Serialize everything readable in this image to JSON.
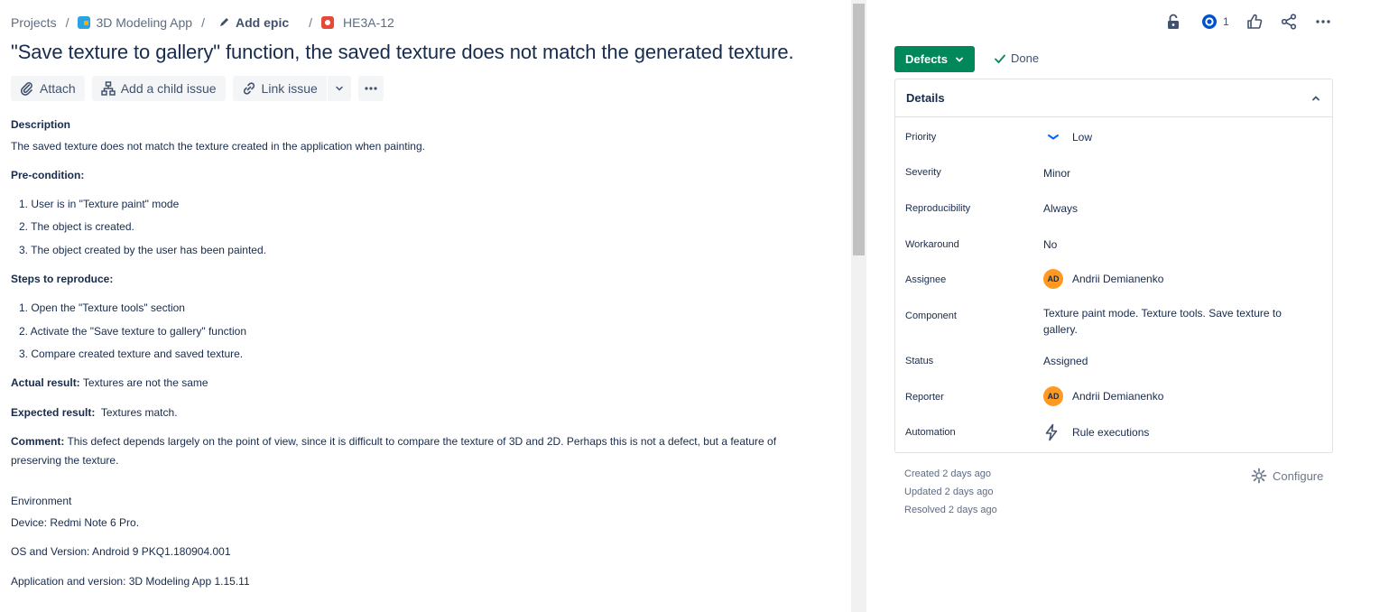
{
  "breadcrumb": {
    "projects": "Projects",
    "separator": "/",
    "app": "3D Modeling App",
    "epic": "Add epic",
    "issue_key": "HE3A-12"
  },
  "issue": {
    "title": "\"Save texture to gallery\" function, the saved texture does not match the generated texture."
  },
  "toolbar": {
    "attach": "Attach",
    "add_child": "Add a child issue",
    "link_issue": "Link issue"
  },
  "body": {
    "description_heading": "Description",
    "description_text": "The saved texture does not match the texture created in the application when painting.",
    "precondition_heading": "Pre-condition:",
    "preconditions": [
      "1. User is in \"Texture paint\" mode",
      "2. The object is created.",
      "3. The object created by the user has been painted."
    ],
    "steps_heading": "Steps to reproduce:",
    "steps": [
      "1. Open the \"Texture tools\" section",
      "2. Activate the \"Save texture to gallery\" function",
      "3. Compare created texture and saved texture."
    ],
    "actual_label": "Actual result:",
    "actual_text": "Textures are not the same",
    "expected_label": "Expected result:",
    "expected_text": "Textures match.",
    "comment_label": "Comment:",
    "comment_text_1": "This defect depends largely on the point of view, since it is difficult to compare the texture of 3D and 2D. Perhaps this is not a defect, but a feature of",
    "comment_text_2": "preserving the texture.",
    "environment_heading": "Environment",
    "device": "Device: Redmi Note 6 Pro.",
    "os": "OS and Version: Android 9 PKQ1.180904.001",
    "application": "Application and version: 3D Modeling App 1.15.11"
  },
  "header_actions": {
    "watch_count": "1"
  },
  "status": {
    "button": "Defects",
    "done": "Done"
  },
  "details": {
    "title": "Details",
    "fields": {
      "priority": {
        "label": "Priority",
        "value": "Low"
      },
      "severity": {
        "label": "Severity",
        "value": "Minor"
      },
      "reproducibility": {
        "label": "Reproducibility",
        "value": "Always"
      },
      "workaround": {
        "label": "Workaround",
        "value": "No"
      },
      "assignee": {
        "label": "Assignee",
        "value": "Andrii Demianenko",
        "initials": "AD"
      },
      "component": {
        "label": "Component",
        "value": "Texture paint mode. Texture tools. Save texture to gallery."
      },
      "status": {
        "label": "Status",
        "value": "Assigned"
      },
      "reporter": {
        "label": "Reporter",
        "value": "Andrii Demianenko",
        "initials": "AD"
      },
      "automation": {
        "label": "Automation",
        "value": "Rule executions"
      }
    }
  },
  "meta": {
    "created": "Created 2 days ago",
    "updated": "Updated 2 days ago",
    "resolved": "Resolved 2 days ago",
    "configure": "Configure"
  },
  "colors": {
    "accent_green": "#00875a",
    "priority_low": "#0065ff",
    "avatar": "#ff991f",
    "bug": "#e5493a"
  }
}
